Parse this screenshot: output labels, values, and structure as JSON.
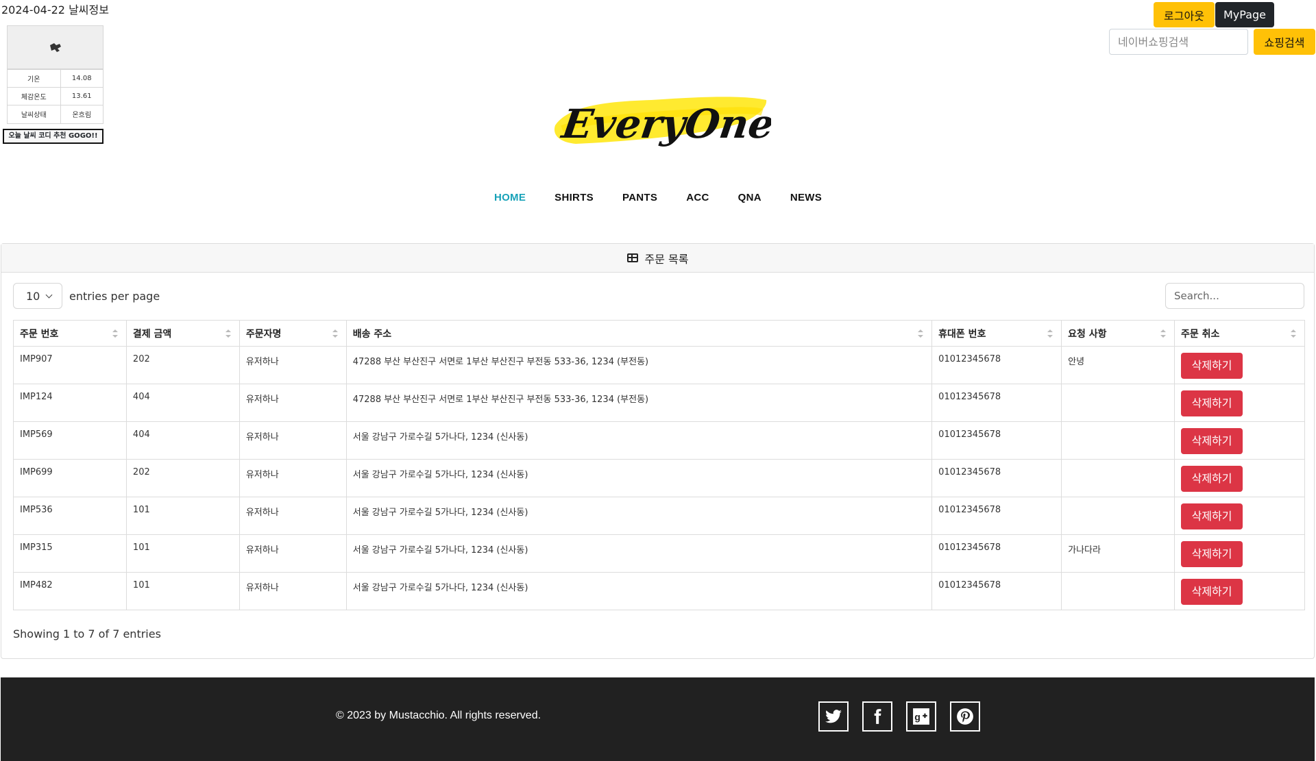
{
  "weather": {
    "title": "2024-04-22 날씨정보",
    "image_icon": "weather-image-icon",
    "rows": [
      {
        "label": "기온",
        "value": "14.08"
      },
      {
        "label": "체감온도",
        "value": "13.61"
      },
      {
        "label": "날씨상태",
        "value": "온흐림"
      }
    ],
    "recommend_button": "오늘 날씨 코디 추천 GOGO!!"
  },
  "header": {
    "logout_label": "로그아웃",
    "mypage_label": "MyPage",
    "search_placeholder": "네이버쇼핑검색",
    "search_button": "쇼핑검색",
    "brand_color": "#ffc107"
  },
  "logo": {
    "text": "EveryOne"
  },
  "nav": {
    "items": [
      "HOME",
      "SHIRTS",
      "PANTS",
      "ACC",
      "QNA",
      "NEWS"
    ],
    "active": "HOME",
    "active_color": "#17a2b8"
  },
  "orders": {
    "card_title": "주문 목록",
    "per_page_value": "10",
    "per_page_label": "entries per page",
    "search_placeholder": "Search...",
    "columns": [
      "주문 번호",
      "결제 금액",
      "주문자명",
      "배송 주소",
      "휴대폰 번호",
      "요청 사항",
      "주문 취소"
    ],
    "rows": [
      {
        "id": "IMP907",
        "amount": "202",
        "name": "유저하나",
        "address": "47288 부산 부산진구 서면로 1부산 부산진구 부전동 533-36, 1234 (부전동)",
        "phone": "01012345678",
        "request": "안녕",
        "action": "삭제하기"
      },
      {
        "id": "IMP124",
        "amount": "404",
        "name": "유저하나",
        "address": "47288 부산 부산진구 서면로 1부산 부산진구 부전동 533-36, 1234 (부전동)",
        "phone": "01012345678",
        "request": "",
        "action": "삭제하기"
      },
      {
        "id": "IMP569",
        "amount": "404",
        "name": "유저하나",
        "address": "서울 강남구 가로수길 5가나다, 1234 (신사동)",
        "phone": "01012345678",
        "request": "",
        "action": "삭제하기"
      },
      {
        "id": "IMP699",
        "amount": "202",
        "name": "유저하나",
        "address": "서울 강남구 가로수길 5가나다, 1234 (신사동)",
        "phone": "01012345678",
        "request": "",
        "action": "삭제하기"
      },
      {
        "id": "IMP536",
        "amount": "101",
        "name": "유저하나",
        "address": "서울 강남구 가로수길 5가나다, 1234 (신사동)",
        "phone": "01012345678",
        "request": "",
        "action": "삭제하기"
      },
      {
        "id": "IMP315",
        "amount": "101",
        "name": "유저하나",
        "address": "서울 강남구 가로수길 5가나다, 1234 (신사동)",
        "phone": "01012345678",
        "request": "가나다라",
        "action": "삭제하기"
      },
      {
        "id": "IMP482",
        "amount": "101",
        "name": "유저하나",
        "address": "서울 강남구 가로수길 5가나다, 1234 (신사동)",
        "phone": "01012345678",
        "request": "",
        "action": "삭제하기"
      }
    ],
    "showing_text": "Showing 1 to 7 of 7 entries",
    "delete_color": "#dc3545"
  },
  "footer": {
    "copyright": "© 2023 by Mustacchio. All rights reserved.",
    "social_icons": [
      "twitter-icon",
      "facebook-icon",
      "google-plus-icon",
      "pinterest-icon"
    ]
  }
}
